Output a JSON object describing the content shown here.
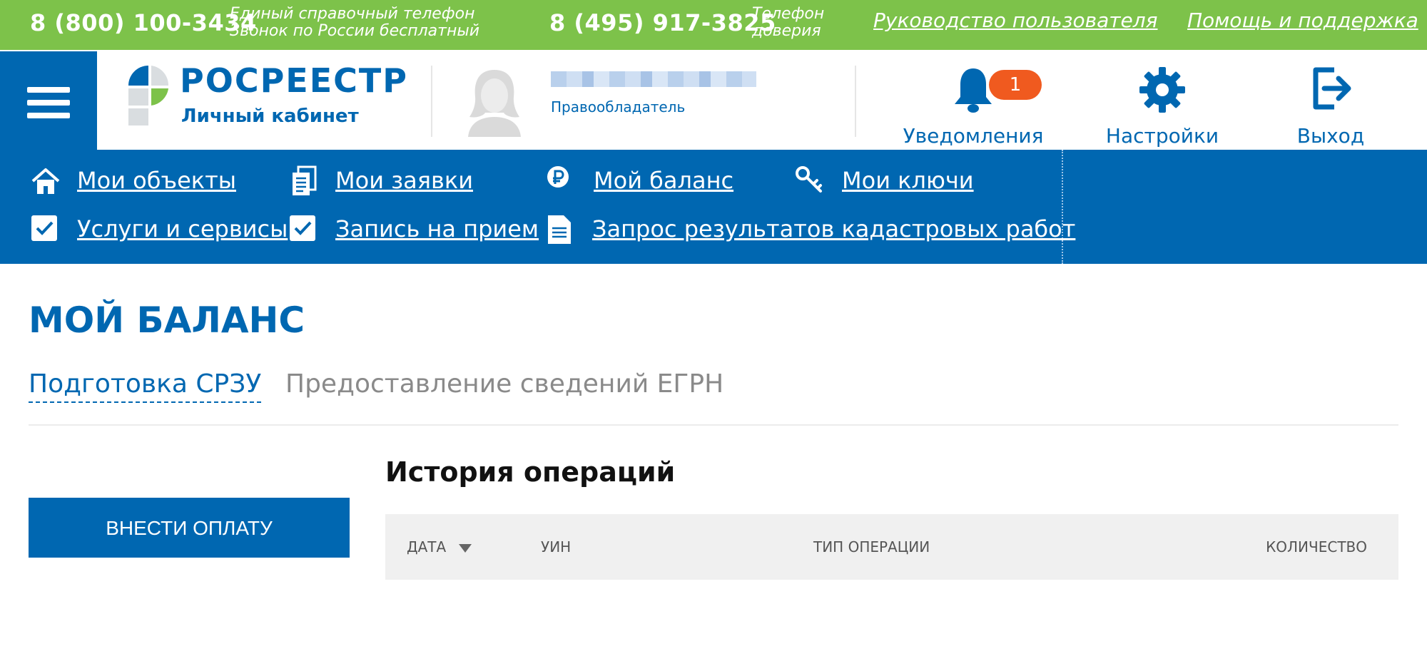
{
  "topbar": {
    "phone1": "8 (800) 100-3434",
    "phone1_caption_line1": "Единый справочный телефон",
    "phone1_caption_line2": "Звонок по России бесплатный",
    "phone2": "8 (495) 917-3825",
    "phone2_caption_line1": "Телефон",
    "phone2_caption_line2": "доверия",
    "link_manual": "Руководство пользователя",
    "link_help": "Помощь и поддержка"
  },
  "header": {
    "logo_brand": "РОСРЕЕСТР",
    "logo_subtitle": "Личный кабинет",
    "user_role": "Правообладатель",
    "notifications_label": "Уведомления",
    "notifications_count": "1",
    "settings_label": "Настройки",
    "logout_label": "Выход"
  },
  "nav": {
    "items": [
      {
        "label": "Мои объекты",
        "icon": "home-icon"
      },
      {
        "label": "Мои заявки",
        "icon": "documents-icon"
      },
      {
        "label": "Мой баланс",
        "icon": "ruble-icon"
      },
      {
        "label": "Мои ключи",
        "icon": "key-icon"
      },
      {
        "label": "Услуги и сервисы",
        "icon": "checkbox-icon"
      },
      {
        "label": "Запись на прием",
        "icon": "checkbox-icon"
      },
      {
        "label": "Запрос результатов кадастровых работ",
        "icon": "document-icon"
      }
    ]
  },
  "main": {
    "title": "МОЙ БАЛАНС",
    "tabs": [
      {
        "label": "Подготовка СРЗУ",
        "active": true
      },
      {
        "label": "Предоставление сведений ЕГРН",
        "active": false
      }
    ],
    "pay_button": "ВНЕСТИ ОПЛАТУ",
    "history_title": "История операций",
    "table": {
      "columns": [
        "ДАТА",
        "УИН",
        "ТИП ОПЕРАЦИИ",
        "КОЛИЧЕСТВО"
      ],
      "rows": []
    }
  },
  "colors": {
    "topbar": "#7dc24a",
    "brand_blue": "#0067b1",
    "badge": "#f05a1f",
    "table_header_bg": "#f0f0f0"
  }
}
